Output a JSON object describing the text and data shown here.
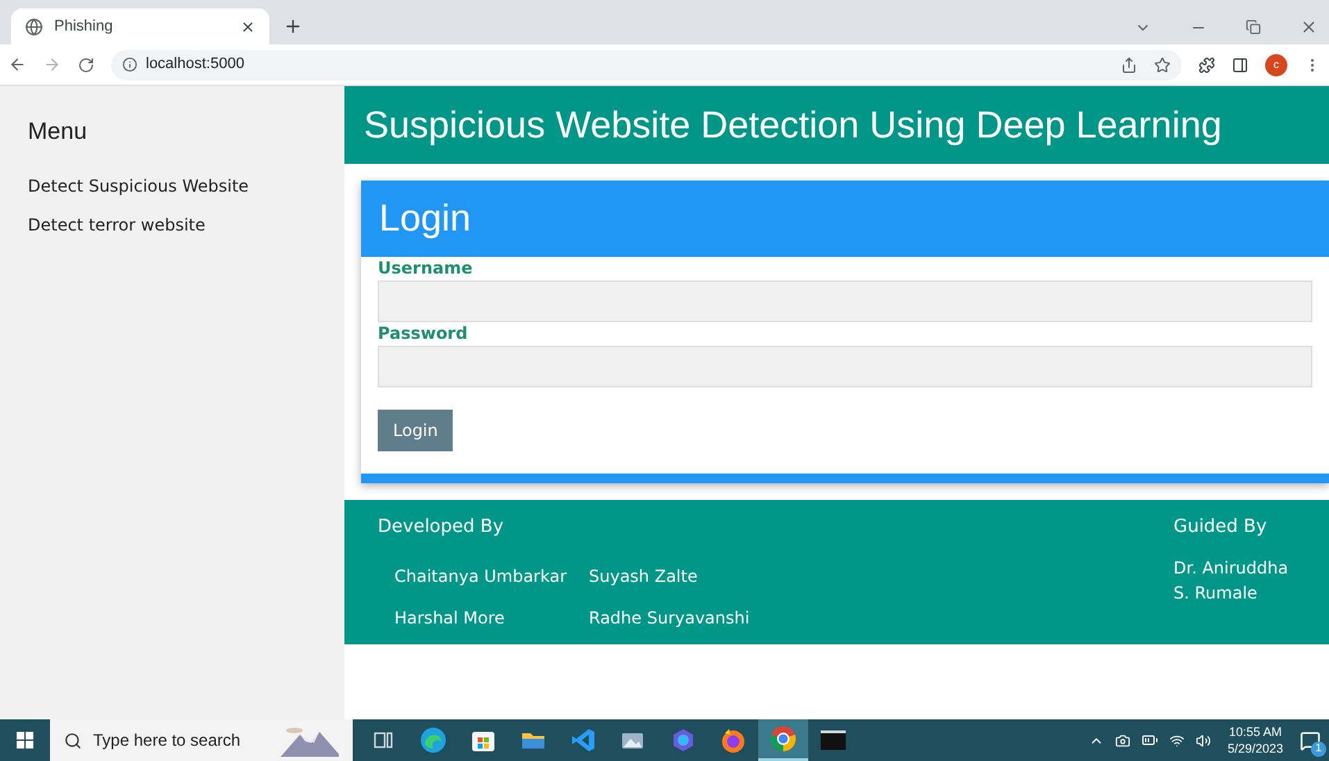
{
  "browser": {
    "tab": {
      "title": "Phishing"
    },
    "address": "localhost:5000",
    "profile": "c"
  },
  "sidebar": {
    "title": "Menu",
    "items": [
      {
        "label": "Detect Suspicious Website",
        "selected": false
      },
      {
        "label": "Detect terror website",
        "selected": false
      }
    ]
  },
  "header": {
    "title": "Suspicious Website Detection Using Deep Learning"
  },
  "login": {
    "title": "Login",
    "fields": [
      {
        "label": "Username"
      },
      {
        "label": "Password"
      }
    ],
    "button": "Login"
  },
  "footer": {
    "developed_heading": "Developed By",
    "developers": [
      "Chaitanya Umbarkar",
      "Suyash Zalte",
      "Harshal More",
      "Radhe Suryavanshi"
    ],
    "guided_heading": "Guided By",
    "guide_lines": [
      "Dr. Aniruddha",
      "S. Rumale"
    ]
  },
  "taskbar": {
    "search_placeholder": "Type here to search",
    "apps": [
      {
        "kind": "taskview",
        "selected": false
      },
      {
        "kind": "edge",
        "selected": false
      },
      {
        "kind": "store",
        "selected": false
      },
      {
        "kind": "folder",
        "selected": false
      },
      {
        "kind": "vscode",
        "selected": false
      },
      {
        "kind": "photos",
        "selected": false
      },
      {
        "kind": "copilot",
        "selected": false
      },
      {
        "kind": "firefox",
        "selected": false
      },
      {
        "kind": "chrome",
        "selected": true
      },
      {
        "kind": "terminal",
        "selected": false
      }
    ],
    "time": "10:55 AM",
    "date": "5/29/2023",
    "notifications": "1"
  }
}
